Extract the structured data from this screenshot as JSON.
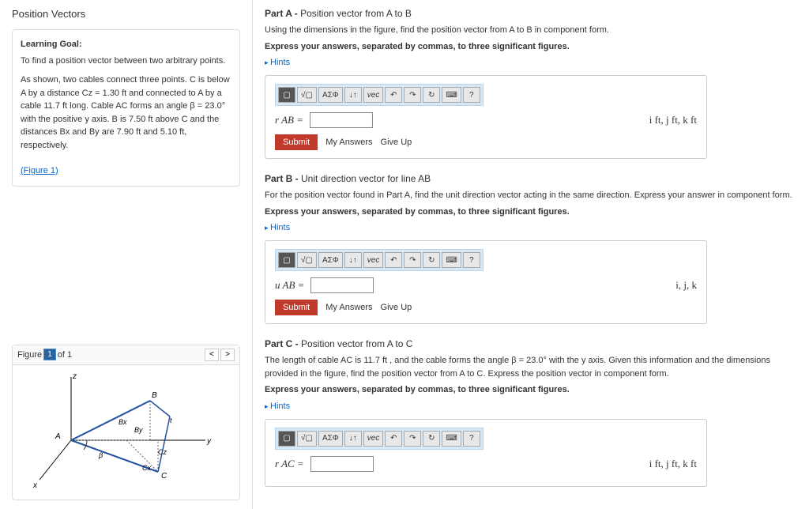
{
  "left": {
    "title": "Position Vectors",
    "goal_label": "Learning Goal:",
    "goal_text": "To find a position vector between two arbitrary points.",
    "desc_html": "As shown, two cables connect three points. C is below A by a distance Cz = 1.30 ft and connected to A by a cable 11.7 ft long. Cable AC forms an angle β = 23.0° with the positive y axis. B is 7.50 ft above C and the distances Bx and By are 7.90 ft and 5.10 ft, respectively.",
    "figure_link": "(Figure 1)",
    "figure_nav": {
      "label": "Figure",
      "current": "1",
      "of": "of 1"
    }
  },
  "parts": {
    "a": {
      "heading_prefix": "Part A - ",
      "heading": "Position vector from A to B",
      "line1": "Using the dimensions in the figure, find the position vector from A to B in component form.",
      "line2": "Express your answers, separated by commas, to three significant figures.",
      "hints": "Hints",
      "var": "r AB =",
      "units": "i ft, j ft, k ft",
      "submit": "Submit",
      "my_answers": "My Answers",
      "give_up": "Give Up"
    },
    "b": {
      "heading_prefix": "Part B - ",
      "heading": "Unit direction vector for line AB",
      "line1": "For the position vector found in Part A, find the unit direction vector acting in the same direction. Express your answer in component form.",
      "line2": "Express your answers, separated by commas, to three significant figures.",
      "hints": "Hints",
      "var": "u AB =",
      "units": "i, j, k",
      "submit": "Submit",
      "my_answers": "My Answers",
      "give_up": "Give Up"
    },
    "c": {
      "heading_prefix": "Part C - ",
      "heading": "Position vector from A to C",
      "line1": "The length of cable AC is 11.7 ft , and the cable forms the angle β = 23.0° with the y axis. Given this information and the dimensions provided in the figure, find the position vector from A to C. Express the position vector in component form.",
      "line2": "Express your answers, separated by commas, to three significant figures.",
      "hints": "Hints",
      "var": "r AC =",
      "units": "i ft, j ft, k ft"
    }
  },
  "toolbar": {
    "templates": "▢",
    "sqrt": "√▢",
    "greek": "ΑΣΦ",
    "arrows": "↓↑",
    "vec": "vec",
    "undo": "↶",
    "redo": "↷",
    "reset": "↻",
    "keyboard": "⌨",
    "help": "?"
  }
}
